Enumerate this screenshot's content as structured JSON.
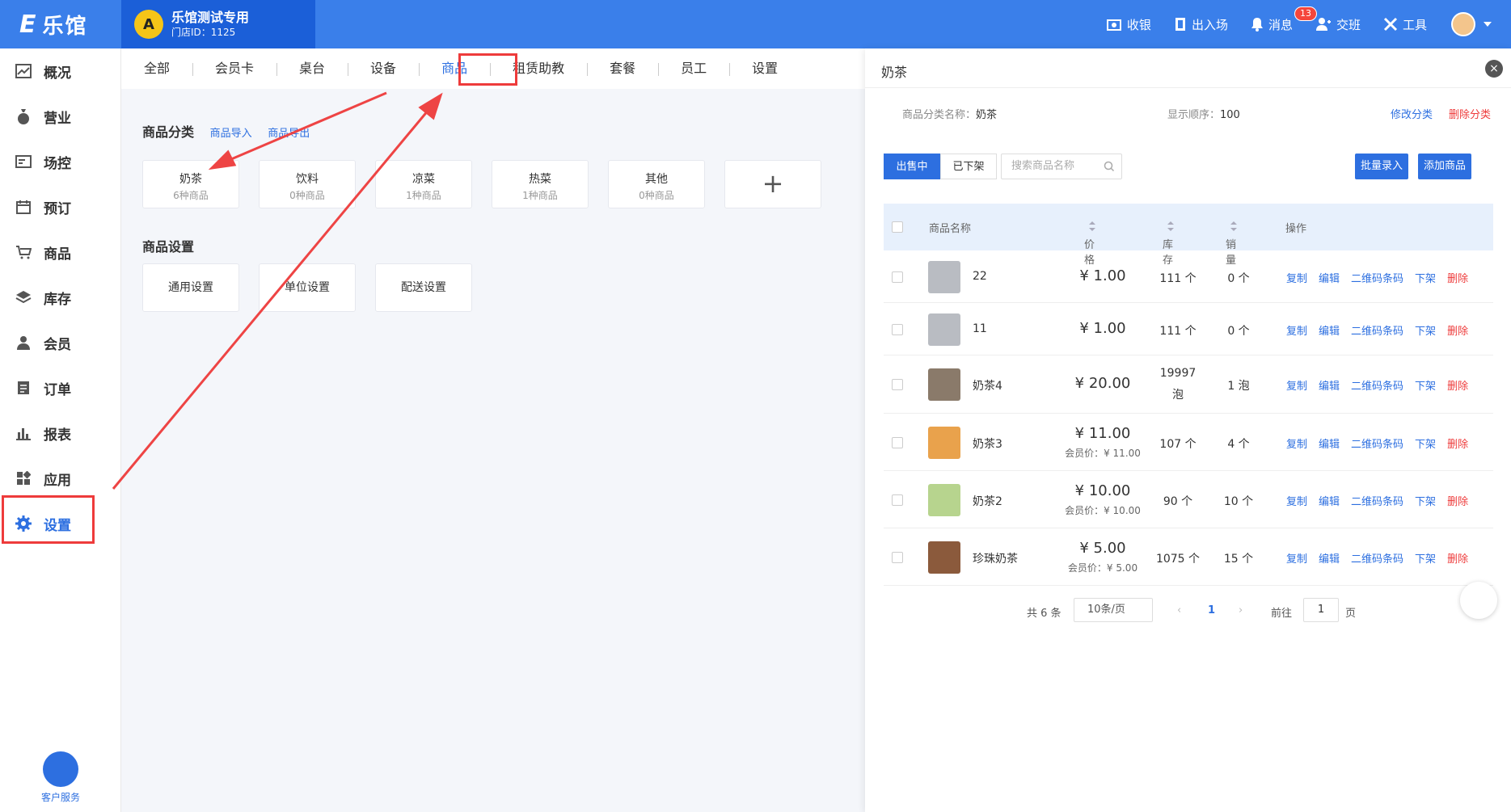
{
  "app": {
    "logo_text": "乐馆",
    "store_name": "乐馆测试专用",
    "store_id": "门店ID：1125"
  },
  "header": {
    "tools": [
      {
        "label": "收银",
        "icon": "cashier-icon"
      },
      {
        "label": "出入场",
        "icon": "entry-icon"
      },
      {
        "label": "消息",
        "icon": "bell-icon",
        "badge": "13"
      },
      {
        "label": "交班",
        "icon": "handover-icon"
      },
      {
        "label": "工具",
        "icon": "tools-icon"
      }
    ]
  },
  "sidebar": {
    "items": [
      {
        "label": "概况",
        "icon": "chart-icon"
      },
      {
        "label": "营业",
        "icon": "money-bag-icon"
      },
      {
        "label": "场控",
        "icon": "monitor-icon"
      },
      {
        "label": "预订",
        "icon": "calendar-icon"
      },
      {
        "label": "商品",
        "icon": "cart-icon"
      },
      {
        "label": "库存",
        "icon": "layers-icon"
      },
      {
        "label": "会员",
        "icon": "user-icon"
      },
      {
        "label": "订单",
        "icon": "order-icon"
      },
      {
        "label": "报表",
        "icon": "bar-chart-icon"
      },
      {
        "label": "应用",
        "icon": "apps-icon"
      },
      {
        "label": "设置",
        "icon": "gear-icon",
        "active": true
      }
    ],
    "customer_service": "客户服务"
  },
  "tabs": [
    "全部",
    "会员卡",
    "桌台",
    "设备",
    "商品",
    "租赁助教",
    "套餐",
    "员工",
    "设置"
  ],
  "active_tab": "商品",
  "main": {
    "category_title": "商品分类",
    "import_link": "商品导入",
    "export_link": "商品导出",
    "categories": [
      {
        "name": "奶茶",
        "count": "6种商品"
      },
      {
        "name": "饮料",
        "count": "0种商品"
      },
      {
        "name": "凉菜",
        "count": "1种商品"
      },
      {
        "name": "热菜",
        "count": "1种商品"
      },
      {
        "name": "其他",
        "count": "0种商品"
      }
    ],
    "settings_title": "商品设置",
    "settings": [
      "通用设置",
      "单位设置",
      "配送设置"
    ]
  },
  "panel": {
    "title": "奶茶",
    "category_name_label": "商品分类名称：",
    "category_name": "奶茶",
    "order_label": "显示顺序：",
    "order_value": "100",
    "edit_link": "修改分类",
    "delete_link": "删除分类",
    "seg_on": "出售中",
    "seg_off": "已下架",
    "search_placeholder": "搜索商品名称",
    "batch_btn": "批量录入",
    "add_btn": "添加商品",
    "columns": [
      "商品名称",
      "价格",
      "库存",
      "销量",
      "操作"
    ],
    "ops": [
      "复制",
      "编辑",
      "二维码条码",
      "下架",
      "删除"
    ],
    "rows": [
      {
        "name": "22",
        "price": "¥ 1.00",
        "member": "",
        "stock": "111 个",
        "stock2": "",
        "sales": "0 个",
        "thumb_color": "#b9bcc2"
      },
      {
        "name": "11",
        "price": "¥ 1.00",
        "member": "",
        "stock": "111 个",
        "stock2": "",
        "sales": "0 个",
        "thumb_color": "#b9bcc2"
      },
      {
        "name": "奶茶4",
        "price": "¥ 20.00",
        "member": "",
        "stock": "19997",
        "stock2": "泡",
        "sales": "1 泡",
        "thumb_color": "#8a7a6a"
      },
      {
        "name": "奶茶3",
        "price": "¥ 11.00",
        "member": "会员价：¥ 11.00",
        "stock": "107 个",
        "stock2": "",
        "sales": "4 个",
        "thumb_color": "#e9a24c"
      },
      {
        "name": "奶茶2",
        "price": "¥ 10.00",
        "member": "会员价：¥ 10.00",
        "stock": "90 个",
        "stock2": "",
        "sales": "10 个",
        "thumb_color": "#b7d48e"
      },
      {
        "name": "珍珠奶茶",
        "price": "¥ 5.00",
        "member": "会员价：¥ 5.00",
        "stock": "1075 个",
        "stock2": "",
        "sales": "15 个",
        "thumb_color": "#8b5a3c"
      }
    ],
    "pager": {
      "total": "共 6 条",
      "size": "10条/页",
      "page": "1",
      "goto": "前往",
      "goto_value": "1",
      "unit": "页"
    }
  },
  "colors": {
    "primary": "#2d6fe0",
    "topbar": "#3a7fea",
    "danger": "#ee3b3b",
    "highlight": "#ee3b3b"
  }
}
